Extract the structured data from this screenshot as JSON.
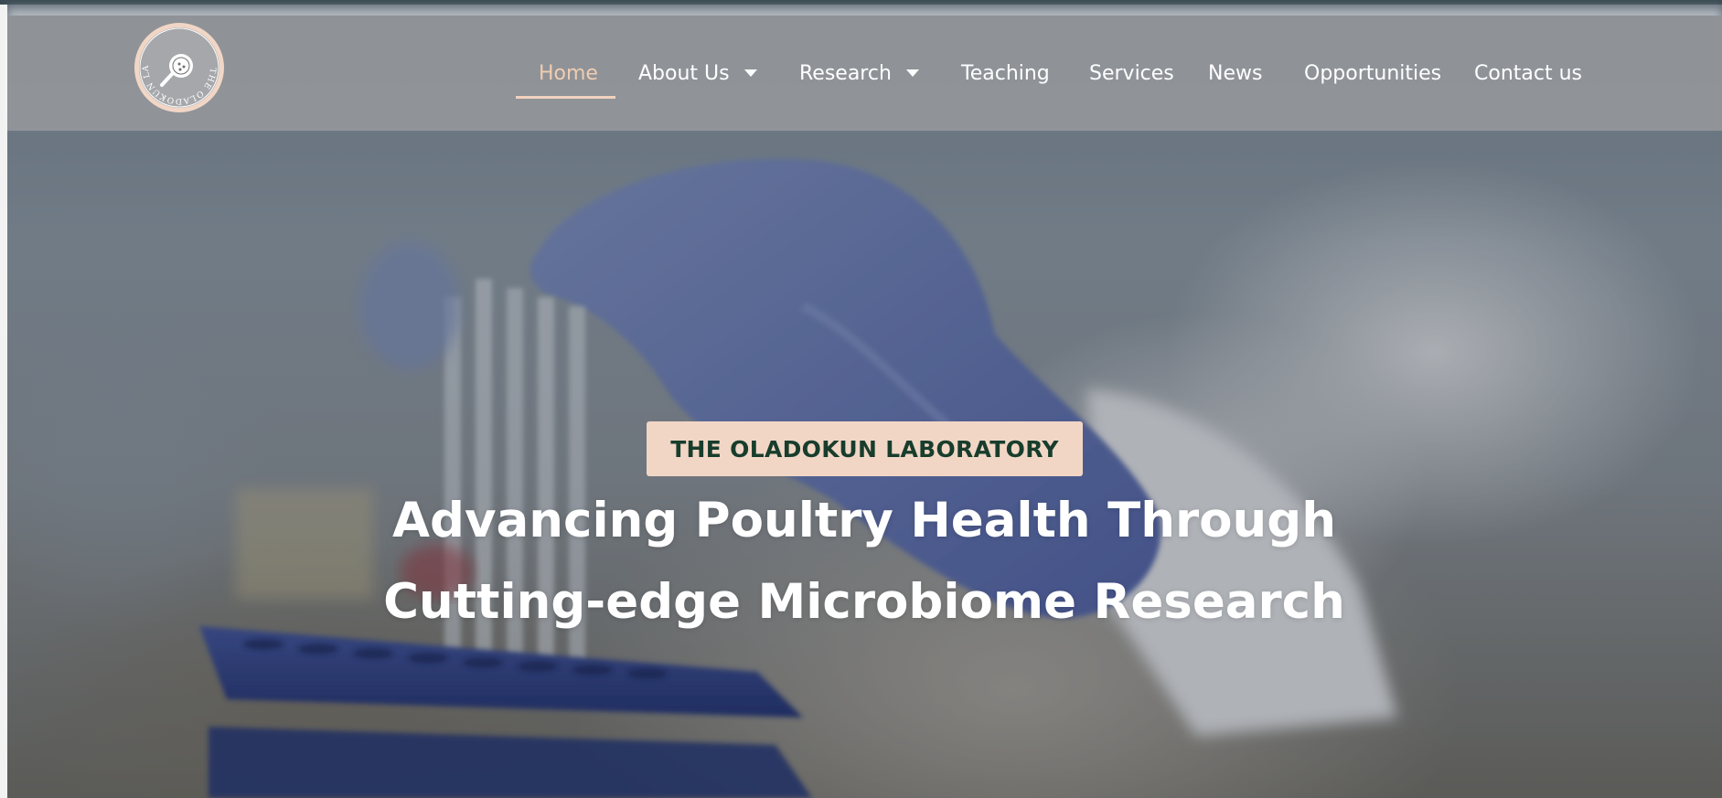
{
  "brand": {
    "logo_icon": "laboratory-seal-logo",
    "logo_text": "THE OLADOKUN LABORATORY"
  },
  "nav": {
    "items": [
      {
        "label": "Home",
        "active": true
      },
      {
        "label": "About Us",
        "has_dropdown": true
      },
      {
        "label": "Research",
        "has_dropdown": true
      },
      {
        "label": "Teaching"
      },
      {
        "label": "Services"
      },
      {
        "label": "News"
      },
      {
        "label": "Opportunities"
      },
      {
        "label": "Contact us"
      }
    ]
  },
  "hero": {
    "badge": "THE OLADOKUN LABORATORY",
    "headline_line1": "Advancing Poultry Health Through",
    "headline_line2": "Cutting-edge Microbiome Research"
  },
  "colors": {
    "header_bg": "#96989c",
    "nav_text": "#ffffff",
    "nav_active": "#f0ccb0",
    "badge_bg": "#f1d6c6",
    "badge_text": "#183d2c",
    "headline_text": "#ffffff"
  }
}
